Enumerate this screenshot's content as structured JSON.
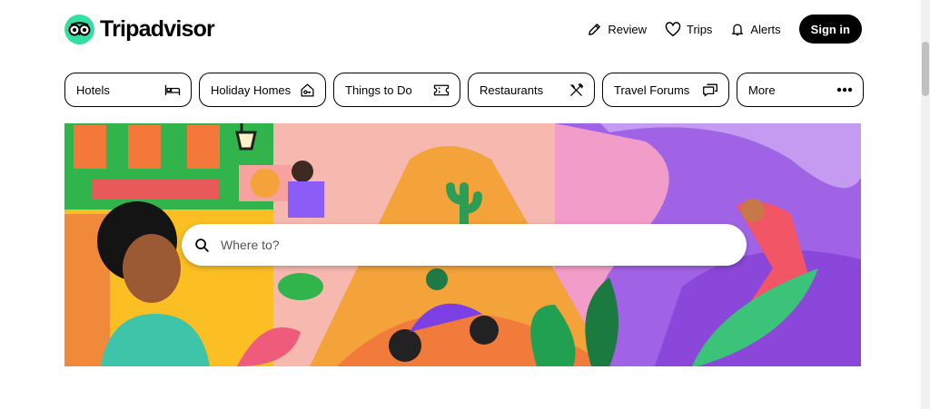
{
  "brand": {
    "name": "Tripadvisor",
    "accent": "#34e0a1"
  },
  "nav": {
    "review": {
      "label": "Review",
      "icon": "pencil-icon"
    },
    "trips": {
      "label": "Trips",
      "icon": "heart-icon"
    },
    "alerts": {
      "label": "Alerts",
      "icon": "bell-icon"
    },
    "signin": {
      "label": "Sign in"
    }
  },
  "categories": [
    {
      "label": "Hotels",
      "icon": "bed-icon"
    },
    {
      "label": "Holiday Homes",
      "icon": "house-key-icon"
    },
    {
      "label": "Things to Do",
      "icon": "ticket-icon"
    },
    {
      "label": "Restaurants",
      "icon": "fork-knife-icon"
    },
    {
      "label": "Travel Forums",
      "icon": "chat-bubbles-icon"
    },
    {
      "label": "More",
      "icon": "ellipsis-icon"
    }
  ],
  "search": {
    "placeholder": "Where to?",
    "value": ""
  }
}
